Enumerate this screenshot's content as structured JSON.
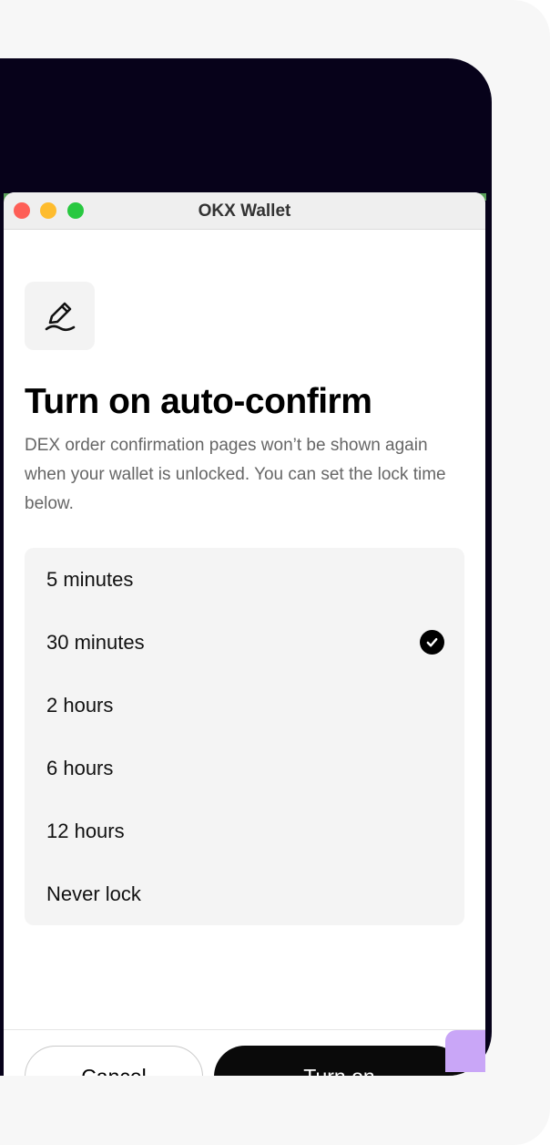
{
  "window": {
    "title": "OKX Wallet"
  },
  "dialog": {
    "icon": "signature-pen-icon",
    "heading": "Turn on auto-confirm",
    "description": "DEX order confirmation pages won’t be shown again when your wallet is unlocked. You can set the lock time below.",
    "options": [
      {
        "label": "5 minutes",
        "selected": false
      },
      {
        "label": "30 minutes",
        "selected": true
      },
      {
        "label": "2 hours",
        "selected": false
      },
      {
        "label": "6 hours",
        "selected": false
      },
      {
        "label": "12 hours",
        "selected": false
      },
      {
        "label": "Never lock",
        "selected": false
      }
    ]
  },
  "footer": {
    "cancel_label": "Cancel",
    "confirm_label": "Turn on"
  },
  "colors": {
    "device_frame": "#07021a",
    "primary_button": "#0a0a0a",
    "option_background": "#f4f4f4",
    "corner_badge": "#c9a6f7"
  }
}
